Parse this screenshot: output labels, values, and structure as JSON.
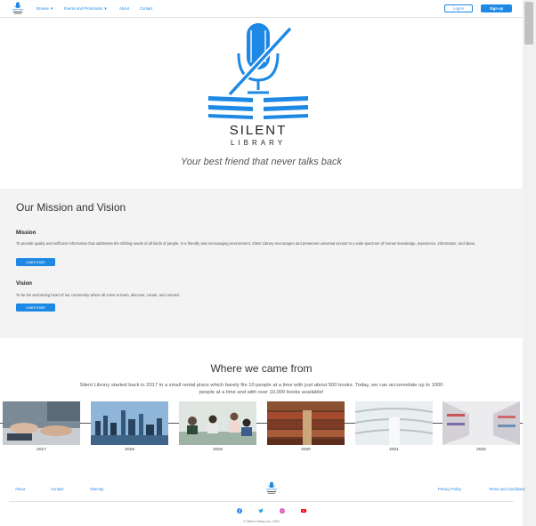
{
  "brand": {
    "logo_line1": "SILENT",
    "logo_line2": "LIBRARY",
    "tagline": "Your best friend that never talks back",
    "blue": "#1e88e5"
  },
  "nav": {
    "browse": "Browse ▼",
    "events": "Events and Promotions ▼",
    "about": "About",
    "contact": "Contact",
    "login": "Log In",
    "signup": "Sign up"
  },
  "mission": {
    "title": "Our Mission and Vision",
    "mission_heading": "Mission",
    "mission_text": "To provide quality and sufficient information that addresses the shifting needs of all kinds of people. In a friendly and encouraging environment, Silent Library encourages and preserves universal access to a wide spectrum of human knowledge, experience, information, and ideas.",
    "mission_button": "Learn more",
    "vision_heading": "Vision",
    "vision_text": "To be the welcoming heart of our community where all come to learn, discover, create, and connect.",
    "vision_button": "Learn more"
  },
  "history": {
    "title": "Where we came from",
    "text": "Silent Library started back in 2017 in a small rental place which barely fits 10 people at a time with just about 500 books. Today, we can accomodate up to 1000 people at a time and with over 10,000 books available!",
    "years": [
      "2017",
      "2018",
      "2019",
      "2020",
      "2021",
      "2022"
    ]
  },
  "footer": {
    "about": "About",
    "contact": "Contact",
    "sitemap": "Sitemap",
    "privacy": "Privacy Policy",
    "terms": "Terms and Conditions",
    "copyright": "© Silent Library Inc. 2022"
  }
}
